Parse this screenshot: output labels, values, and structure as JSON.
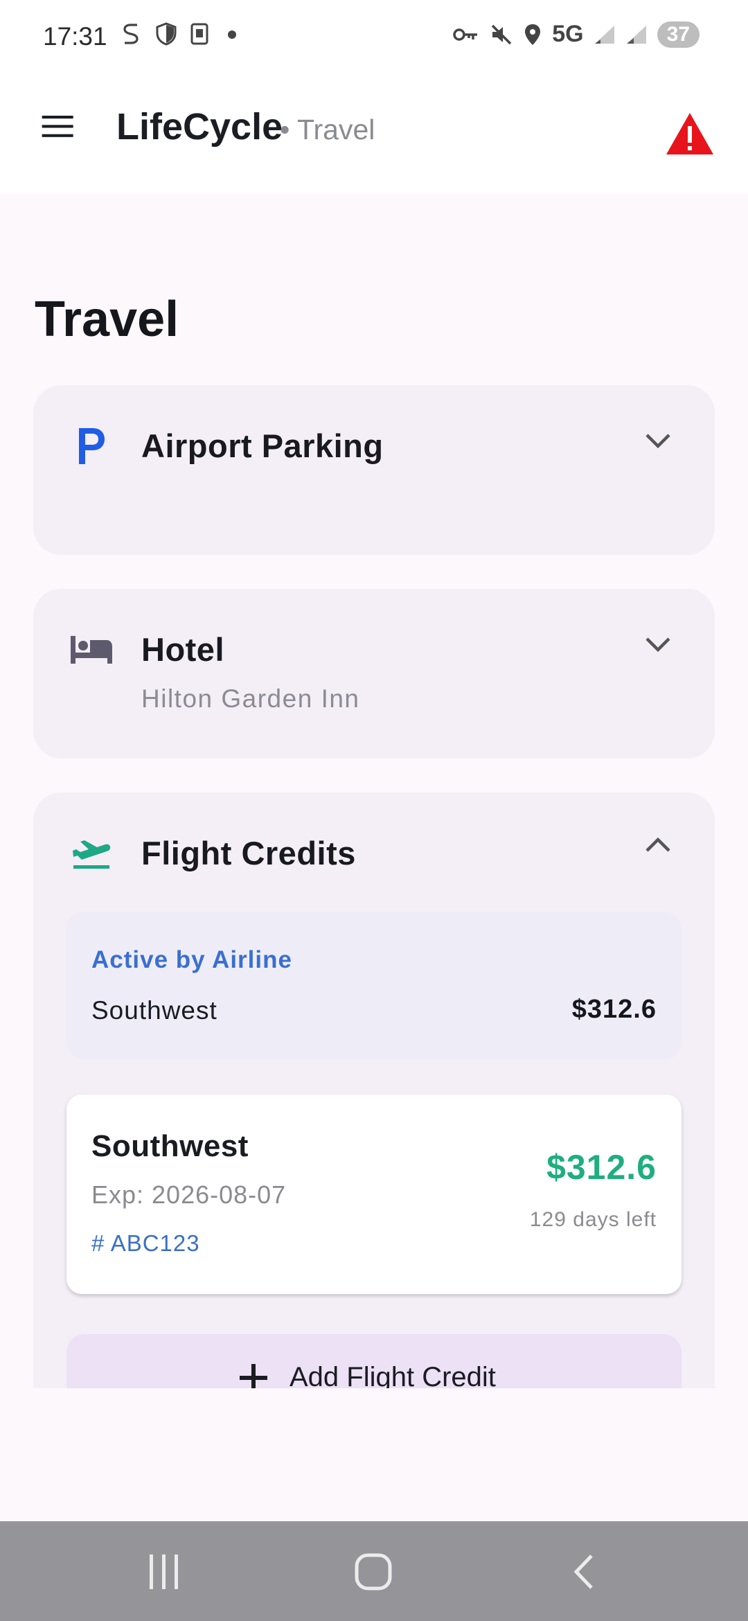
{
  "status_bar": {
    "time": "17:31",
    "network": "5G",
    "battery": "37"
  },
  "app_bar": {
    "title": "LifeCycle",
    "subtitle": "• Travel",
    "colors": {
      "warning": "#e8141b"
    }
  },
  "page": {
    "title": "Travel"
  },
  "sections": [
    {
      "title": "Airport Parking",
      "subtitle": "",
      "icon": "parking-icon",
      "expanded": false
    },
    {
      "title": "Hotel",
      "subtitle": "Hilton Garden Inn",
      "icon": "bed-icon",
      "expanded": false
    },
    {
      "title": "Flight Credits",
      "subtitle": "",
      "icon": "flight-takeoff-icon",
      "expanded": true
    }
  ],
  "flight_credits": {
    "summary": {
      "label": "Active by Airline",
      "airline": "Southwest",
      "amount": "$312.6"
    },
    "credits": [
      {
        "airline": "Southwest",
        "expiration": "Exp: 2026-08-07",
        "code": "# ABC123",
        "amount": "$312.6",
        "days_left": "129 days left"
      }
    ],
    "add_label": "Add Flight Credit",
    "colors": {
      "amount": "#1fae7f",
      "accent": "#3a6fd1"
    }
  }
}
